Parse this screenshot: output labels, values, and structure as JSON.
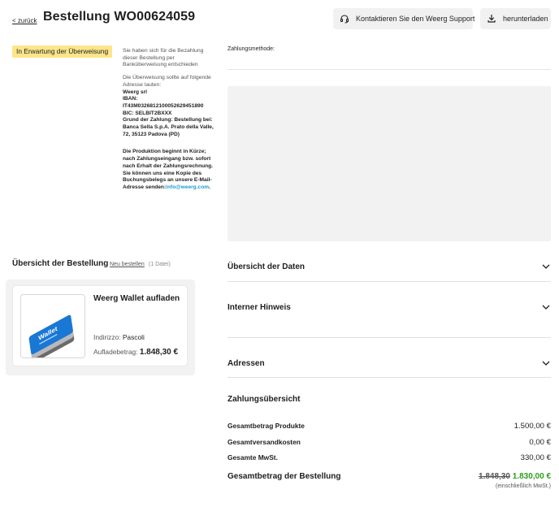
{
  "header": {
    "back_label": "< zurück",
    "title": "Bestellung WO00624059",
    "support_button": "Kontaktieren Sie den Weerg Support",
    "support_icon": "headset-icon",
    "download_button": "herunterladen",
    "download_icon": "download-icon"
  },
  "payment": {
    "status": "In Erwartung der Überweisung",
    "status_color": "#fde58a",
    "intro": "Sie haben sich für die Bezahlung dieser Bestellung per Banküberweisung entschieden",
    "address_intro": "Die Überweisung sollte auf folgende Adresse lauten:",
    "company": "Weerg srl",
    "iban_label": "IBAN:",
    "iban": "IT43M0326812100052629451890",
    "bic": "BIC: SELBIT2BXXX",
    "reason": "Grund der Zahlung: Bestellung bei: Banca Sella S.p.A. Prato della Valle, 72, 35123 Padova (PD)",
    "production_note": "Die Produktion beginnt in Kürze; nach Zahlungseingang bzw. sofort nach Erhalt der Zahlungsrechnung.",
    "copy_note": "Sie können uns eine Kopie des Buchungsbelegs an unsere E-Mail-Adresse senden:",
    "email": "info@weerg.com",
    "email_suffix": ".",
    "method_label": "Zahlungsmethode:"
  },
  "overview": {
    "title": "Übersicht der Bestellung",
    "new_order_link": "Neu bestellen",
    "file_count": "(1 Datei)",
    "product": {
      "name": "Weerg Wallet aufladen",
      "address_label": "Indirizzo: ",
      "address_value": "Pascoli",
      "amount_label": "Aufladebetrag: ",
      "amount_value": "1.848,30 €",
      "thumb_label": "Wallet"
    }
  },
  "accordions": [
    {
      "title": "Übersicht der Daten"
    },
    {
      "title": "Interner Hinweis"
    },
    {
      "title": "Adressen"
    }
  ],
  "summary": {
    "title": "Zahlungsübersicht",
    "rows": [
      {
        "label": "Gesamtbetrag Produkte",
        "value": "1.500,00 €"
      },
      {
        "label": "Gesamtversandkosten",
        "value": "0,00 €"
      },
      {
        "label": "Gesamte MwSt.",
        "value": "330,00 €"
      }
    ],
    "total_label": "Gesamtbetrag der Bestellung",
    "total_old": "1.848,30",
    "total_new": "1.830,00 €",
    "vat_note": "(einschließlich MwSt.)",
    "total_new_color": "#2e9e1c"
  }
}
